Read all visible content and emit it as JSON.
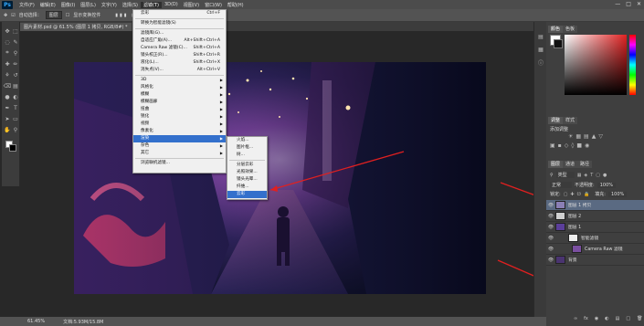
{
  "app": {
    "logo": "Ps"
  },
  "menubar": {
    "items": [
      "文件(F)",
      "编辑(E)",
      "图像(I)",
      "图层(L)",
      "文字(Y)",
      "选择(S)",
      "滤镜(T)",
      "3D(D)",
      "视图(V)",
      "窗口(W)",
      "帮助(H)"
    ],
    "active_index": 6
  },
  "options": {
    "auto_select": "自动选择：",
    "auto_select_value": "图层",
    "show_transform": "显示变换控件"
  },
  "document": {
    "tab_title": "图片素材.psd @ 61.5% (图层 1 拷贝, RGB/8#) *"
  },
  "status": {
    "zoom": "61.45%",
    "doc_size": "文档:5.93M/15.8M"
  },
  "filter_menu": {
    "items": [
      {
        "label": "云彩",
        "shortcut": "Ctrl+F",
        "submenu": false
      },
      {
        "sep": true
      },
      {
        "label": "转换为智能滤镜(S)",
        "shortcut": "",
        "submenu": false
      },
      {
        "sep": true
      },
      {
        "label": "滤镜库(G)...",
        "shortcut": "",
        "submenu": false
      },
      {
        "label": "自适应广角(A)...",
        "shortcut": "Alt+Shift+Ctrl+A",
        "submenu": false
      },
      {
        "label": "Camera Raw 滤镜(C)...",
        "shortcut": "Shift+Ctrl+A",
        "submenu": false
      },
      {
        "label": "镜头校正(R)...",
        "shortcut": "Shift+Ctrl+R",
        "submenu": false
      },
      {
        "label": "液化(L)...",
        "shortcut": "Shift+Ctrl+X",
        "submenu": false
      },
      {
        "label": "消失点(V)...",
        "shortcut": "Alt+Ctrl+V",
        "submenu": false
      },
      {
        "sep": true
      },
      {
        "label": "3D",
        "shortcut": "",
        "submenu": true
      },
      {
        "label": "风格化",
        "shortcut": "",
        "submenu": true
      },
      {
        "label": "模糊",
        "shortcut": "",
        "submenu": true
      },
      {
        "label": "模糊画廊",
        "shortcut": "",
        "submenu": true
      },
      {
        "label": "扭曲",
        "shortcut": "",
        "submenu": true
      },
      {
        "label": "锐化",
        "shortcut": "",
        "submenu": true
      },
      {
        "label": "视频",
        "shortcut": "",
        "submenu": true
      },
      {
        "label": "像素化",
        "shortcut": "",
        "submenu": true
      },
      {
        "label": "渲染",
        "shortcut": "",
        "submenu": true,
        "highlighted": true
      },
      {
        "label": "杂色",
        "shortcut": "",
        "submenu": true
      },
      {
        "label": "其它",
        "shortcut": "",
        "submenu": true
      },
      {
        "sep": true
      },
      {
        "label": "浏览联机滤镜...",
        "shortcut": "",
        "submenu": false
      }
    ]
  },
  "render_submenu": {
    "items": [
      {
        "label": "火焰..."
      },
      {
        "label": "图片框..."
      },
      {
        "label": "树..."
      },
      {
        "sep": true
      },
      {
        "label": "分层云彩"
      },
      {
        "label": "光照效果..."
      },
      {
        "label": "镜头光晕..."
      },
      {
        "label": "纤维..."
      },
      {
        "label": "云彩",
        "highlighted": true
      }
    ]
  },
  "panels": {
    "color_tabs": [
      "颜色",
      "色板"
    ],
    "adjust_tabs": [
      "调整",
      "样式"
    ],
    "adjust_title": "添加调整",
    "layers_tabs": [
      "图层",
      "通道",
      "路径"
    ],
    "blend_mode": "正常",
    "opacity_label": "不透明度:",
    "opacity": "100%",
    "lock_label": "锁定:",
    "fill_label": "填充:",
    "fill": "100%",
    "kind_label": "类型"
  },
  "layers": [
    {
      "name": "图层 1 拷贝",
      "selected": true
    },
    {
      "name": "图层 2",
      "selected": false
    },
    {
      "name": "图层 1",
      "selected": false
    },
    {
      "name": "智能滤镜",
      "selected": false
    },
    {
      "name": "Camera Raw 滤镜",
      "selected": false
    },
    {
      "name": "背景",
      "selected": false
    }
  ],
  "colors": {
    "accent": "#3370cc",
    "arrow": "#e02020",
    "selected_layer": "#5a6a82"
  }
}
